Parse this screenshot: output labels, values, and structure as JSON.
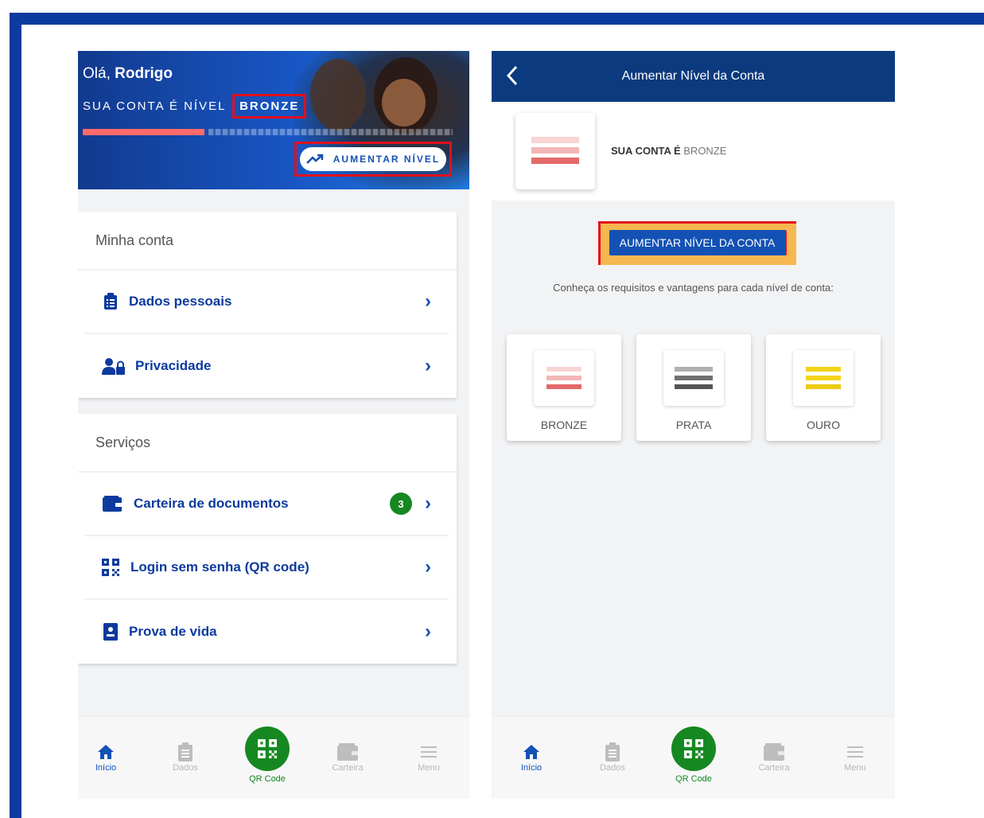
{
  "left": {
    "greeting_prefix": "Olá,",
    "greeting_name": "Rodrigo",
    "level_label": "SUA CONTA É NÍVEL",
    "level_value": "BRONZE",
    "progress_fraction": 0.33,
    "upgrade_button": "AUMENTAR NÍVEL",
    "my_account": {
      "title": "Minha conta",
      "items": [
        {
          "label": "Dados pessoais",
          "icon": "clipboard-icon"
        },
        {
          "label": "Privacidade",
          "icon": "user-lock-icon"
        }
      ]
    },
    "services": {
      "title": "Serviços",
      "items": [
        {
          "label": "Carteira de documentos",
          "icon": "wallet-icon",
          "badge": "3"
        },
        {
          "label": "Login sem senha (QR code)",
          "icon": "qr-code-icon"
        },
        {
          "label": "Prova de vida",
          "icon": "id-badge-icon"
        }
      ]
    }
  },
  "right": {
    "header_title": "Aumentar Nível da Conta",
    "account_label": "SUA CONTA É",
    "account_value": "BRONZE",
    "cta_button": "AUMENTAR NÍVEL DA CONTA",
    "info_text": "Conheça os requisitos e vantagens para cada nível de conta:",
    "tiers": [
      {
        "label": "BRONZE",
        "color": "#f08a8a"
      },
      {
        "label": "PRATA",
        "color": "#707070"
      },
      {
        "label": "OURO",
        "color": "#f2d31a"
      }
    ]
  },
  "nav": {
    "home": "Início",
    "data": "Dados",
    "qr": "QR Code",
    "wallet": "Carteira",
    "menu": "Menu"
  },
  "colors": {
    "primary": "#1351b4",
    "dark_blue": "#0c3a9e",
    "green": "#168821",
    "highlight_red": "#e0101c",
    "highlight_orange": "#f6b751"
  }
}
